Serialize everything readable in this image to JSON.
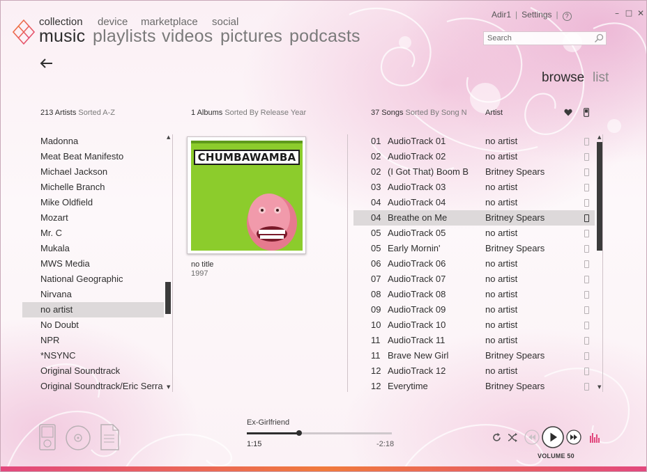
{
  "user": "Adir1",
  "settings_label": "Settings",
  "help_label": "?",
  "window_controls": {
    "minimize": "–",
    "maximize": "□",
    "close": "✕"
  },
  "nav": {
    "primary": [
      {
        "label": "collection",
        "active": true
      },
      {
        "label": "device"
      },
      {
        "label": "marketplace"
      },
      {
        "label": "social"
      }
    ],
    "secondary": [
      {
        "label": "music",
        "active": true
      },
      {
        "label": "playlists"
      },
      {
        "label": "videos"
      },
      {
        "label": "pictures"
      },
      {
        "label": "podcasts"
      }
    ]
  },
  "search": {
    "placeholder": "Search",
    "icon": "search-icon"
  },
  "view_modes": {
    "browse": "browse",
    "list": "list",
    "active": "browse"
  },
  "artists": {
    "count": "213 Artists",
    "sort": "Sorted A-Z",
    "items": [
      "Madonna",
      "Meat Beat Manifesto",
      "Michael Jackson",
      "Michelle Branch",
      "Mike Oldfield",
      "Mozart",
      "Mr. C",
      "Mukala",
      "MWS Media",
      "National Geographic",
      "Nirvana",
      "no artist",
      "No Doubt",
      "NPR",
      "*NSYNC",
      "Original Soundtrack",
      "Original Soundtrack/Eric Serra"
    ],
    "selected_index": 11
  },
  "albums": {
    "count": "1 Albums",
    "sort": "Sorted By Release Year",
    "items": [
      {
        "cover_text": "CHUMBAWAMBA",
        "title": "no title",
        "year": "1997"
      }
    ]
  },
  "songs": {
    "count": "37 Songs",
    "sort": "Sorted By Song N",
    "artist_col": "Artist",
    "rows": [
      {
        "num": "01",
        "title": "AudioTrack 01",
        "artist": "no artist"
      },
      {
        "num": "02",
        "title": "AudioTrack 02",
        "artist": "no artist"
      },
      {
        "num": "02",
        "title": "(I Got That) Boom B",
        "artist": "Britney Spears"
      },
      {
        "num": "03",
        "title": "AudioTrack 03",
        "artist": "no artist"
      },
      {
        "num": "04",
        "title": "AudioTrack 04",
        "artist": "no artist"
      },
      {
        "num": "04",
        "title": "Breathe on Me",
        "artist": "Britney Spears"
      },
      {
        "num": "05",
        "title": "AudioTrack 05",
        "artist": "no artist"
      },
      {
        "num": "05",
        "title": "Early Mornin'",
        "artist": "Britney Spears"
      },
      {
        "num": "06",
        "title": "AudioTrack 06",
        "artist": "no artist"
      },
      {
        "num": "07",
        "title": "AudioTrack 07",
        "artist": "no artist"
      },
      {
        "num": "08",
        "title": "AudioTrack 08",
        "artist": "no artist"
      },
      {
        "num": "09",
        "title": "AudioTrack 09",
        "artist": "no artist"
      },
      {
        "num": "10",
        "title": "AudioTrack 10",
        "artist": "no artist"
      },
      {
        "num": "11",
        "title": "AudioTrack 11",
        "artist": "no artist"
      },
      {
        "num": "11",
        "title": "Brave New Girl",
        "artist": "Britney Spears"
      },
      {
        "num": "12",
        "title": "AudioTrack 12",
        "artist": "no artist"
      },
      {
        "num": "12",
        "title": "Everytime",
        "artist": "Britney Spears"
      }
    ],
    "selected_index": 5
  },
  "player": {
    "now_playing": "Ex-Girlfriend",
    "elapsed": "1:15",
    "remaining": "-2:18",
    "progress": 0.36,
    "volume_label": "VOLUME 50"
  },
  "colors": {
    "accent": "#e2487e",
    "selection": "#ddd9da",
    "text": "#2e2e2e"
  }
}
